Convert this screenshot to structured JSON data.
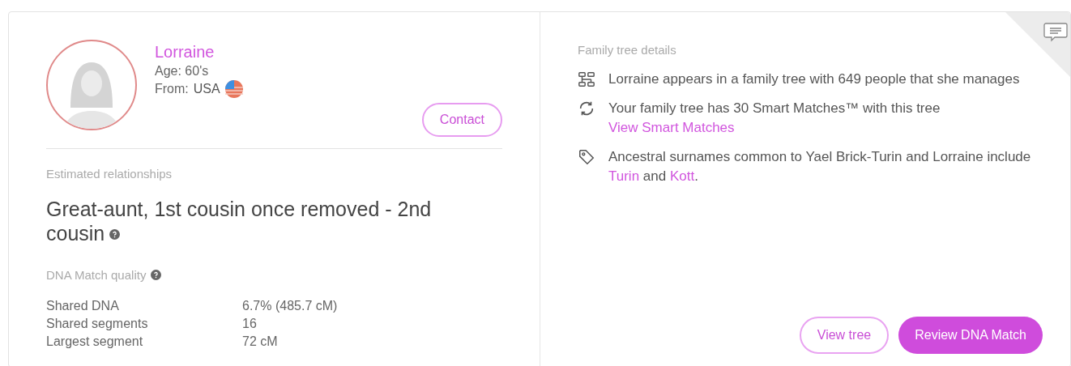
{
  "profile": {
    "name": "Lorraine",
    "age": "Age: 60's",
    "from_label": "From:",
    "country": "USA",
    "contact_button": "Contact"
  },
  "relationships": {
    "heading": "Estimated relationships",
    "text": "Great-aunt, 1st cousin once removed - 2nd cousin"
  },
  "dna_quality": {
    "heading": "DNA Match quality",
    "rows": [
      {
        "label": "Shared DNA",
        "value": "6.7% (485.7 cM)"
      },
      {
        "label": "Shared segments",
        "value": "16"
      },
      {
        "label": "Largest segment",
        "value": "72 cM"
      }
    ]
  },
  "family_tree": {
    "heading": "Family tree details",
    "items": [
      {
        "kind": "tree",
        "parts": [
          {
            "kind": "text",
            "text": "Lorraine appears in a family tree with 649 people that she manages"
          }
        ]
      },
      {
        "kind": "sync",
        "parts": [
          {
            "kind": "text",
            "text": "Your family tree has 30 Smart Matches™ with this tree"
          },
          {
            "kind": "line_link",
            "text": "View Smart Matches"
          }
        ]
      },
      {
        "kind": "tag",
        "parts": [
          {
            "kind": "text",
            "text": "Ancestral surnames common to Yael Brick-Turin and Lorraine include "
          },
          {
            "kind": "link",
            "text": "Turin"
          },
          {
            "kind": "text",
            "text": " and "
          },
          {
            "kind": "link",
            "text": "Kott"
          },
          {
            "kind": "text",
            "text": "."
          }
        ]
      }
    ]
  },
  "actions": [
    {
      "label": "View tree",
      "kind": "outline"
    },
    {
      "label": "Review DNA Match",
      "kind": "filled"
    }
  ]
}
